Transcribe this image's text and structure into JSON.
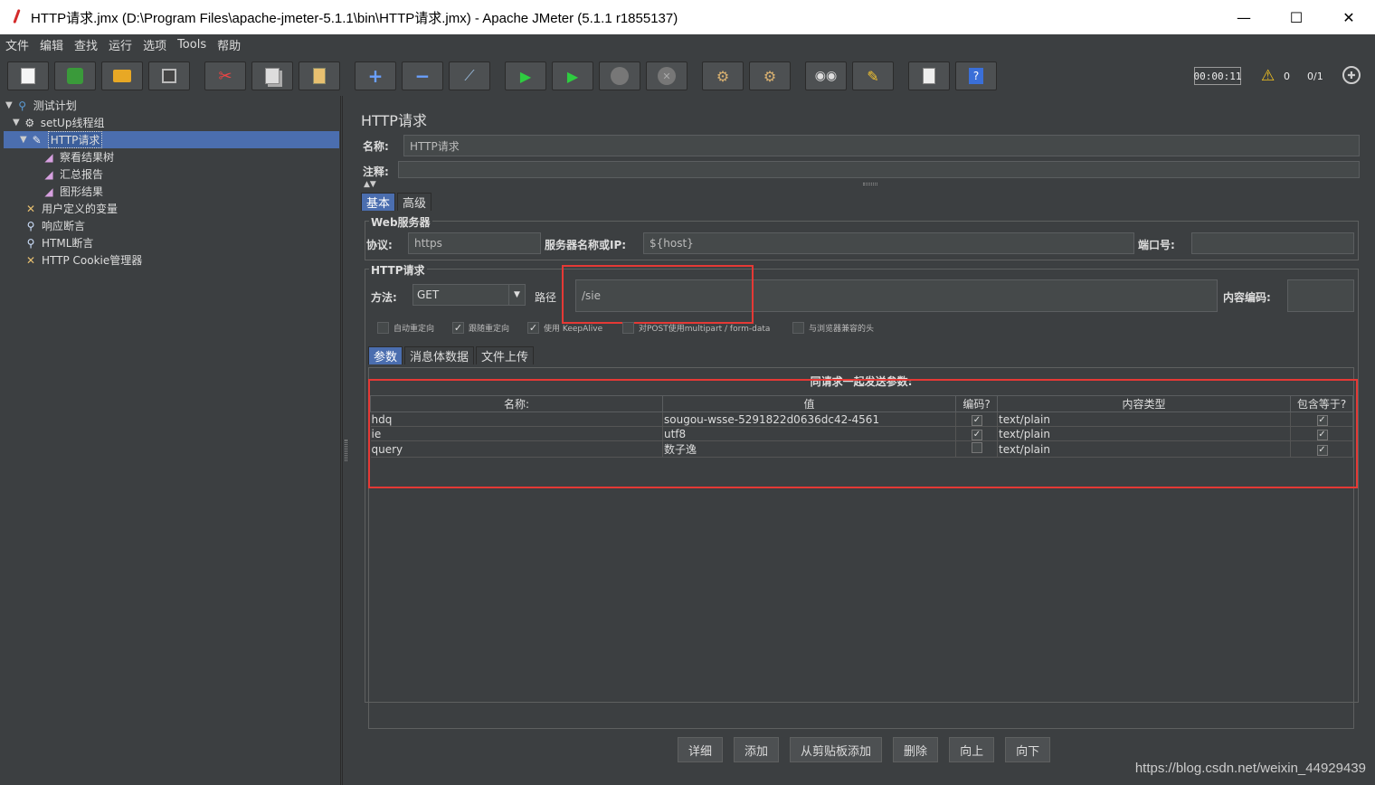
{
  "window": {
    "title": "HTTP请求.jmx (D:\\Program Files\\apache-jmeter-5.1.1\\bin\\HTTP请求.jmx) - Apache JMeter (5.1.1 r1855137)",
    "minimize": "—",
    "maximize": "☐",
    "close": "✕"
  },
  "menu": [
    "文件",
    "编辑",
    "查找",
    "运行",
    "选项",
    "Tools",
    "帮助"
  ],
  "toolbar": {
    "icons": [
      "new-icon",
      "templates-icon",
      "open-icon",
      "save-icon",
      "cut-icon",
      "copy-icon",
      "paste-icon",
      "expand-icon",
      "collapse-icon",
      "toggle-icon",
      "start-icon",
      "start-no-pause-icon",
      "stop-icon",
      "shutdown-icon",
      "clear-icon",
      "clear-all-icon",
      "search-icon",
      "reset-search-icon",
      "function-helper-icon",
      "help-icon"
    ],
    "timer": "00:00:11",
    "warning_count": "0",
    "threads": "0/1"
  },
  "tree": {
    "items": [
      {
        "label": "测试计划",
        "icon": "test-plan-icon"
      },
      {
        "label": "setUp线程组",
        "icon": "gear-icon"
      },
      {
        "label": "HTTP请求",
        "icon": "sampler-icon"
      },
      {
        "label": "察看结果树",
        "icon": "listener-icon"
      },
      {
        "label": "汇总报告",
        "icon": "listener-icon"
      },
      {
        "label": "图形结果",
        "icon": "listener-icon"
      },
      {
        "label": "用户定义的变量",
        "icon": "config-icon"
      },
      {
        "label": "响应断言",
        "icon": "assertion-icon"
      },
      {
        "label": "HTML断言",
        "icon": "assertion-icon"
      },
      {
        "label": "HTTP Cookie管理器",
        "icon": "config-icon"
      }
    ]
  },
  "panel": {
    "title": "HTTP请求",
    "name_label": "名称:",
    "name_value": "HTTP请求",
    "comment_label": "注释:",
    "comment_value": "",
    "tabs": [
      "基本",
      "高级"
    ],
    "web_server": {
      "title": "Web服务器",
      "protocol_label": "协议:",
      "protocol_value": "https",
      "server_label": "服务器名称或IP:",
      "server_value": "${host}",
      "port_label": "端口号:",
      "port_value": ""
    },
    "http_request": {
      "title": "HTTP请求",
      "method_label": "方法:",
      "method_value": "GET",
      "path_label": "路径",
      "path_value": "/sie",
      "encoding_label": "内容编码:",
      "encoding_value": "",
      "options": [
        {
          "label": "自动重定向",
          "checked": false
        },
        {
          "label": "跟随重定向",
          "checked": true
        },
        {
          "label": "使用 KeepAlive",
          "checked": true
        },
        {
          "label": "对POST使用multipart / form-data",
          "checked": false
        },
        {
          "label": "与浏览器兼容的头",
          "checked": false
        }
      ]
    },
    "param_tabs": [
      "参数",
      "消息体数据",
      "文件上传"
    ],
    "params_caption": "同请求一起发送参数:",
    "columns": [
      "名称:",
      "值",
      "编码?",
      "内容类型",
      "包含等于?"
    ],
    "rows": [
      {
        "name": "hdq",
        "value": "sougou-wsse-5291822d0636dc42-4561",
        "encode": true,
        "content_type": "text/plain",
        "include_equals": true
      },
      {
        "name": "ie",
        "value": "utf8",
        "encode": true,
        "content_type": "text/plain",
        "include_equals": true
      },
      {
        "name": "query",
        "value": "数子逸",
        "encode": false,
        "content_type": "text/plain",
        "include_equals": true
      }
    ],
    "buttons": [
      "详细",
      "添加",
      "从剪贴板添加",
      "删除",
      "向上",
      "向下"
    ]
  },
  "watermark": "https://blog.csdn.net/weixin_44929439",
  "colors": {
    "background": "#3c3f41",
    "selection": "#4b6eaf",
    "highlight": "#e53935"
  }
}
